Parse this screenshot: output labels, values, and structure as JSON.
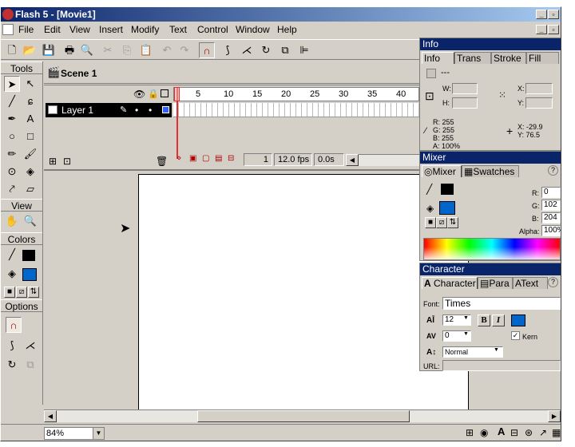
{
  "window": {
    "title": "Flash 5 - [Movie1]"
  },
  "menu": {
    "items": [
      "File",
      "Edit",
      "View",
      "Insert",
      "Modify",
      "Text",
      "Control",
      "Window",
      "Help"
    ]
  },
  "tools": {
    "tools_label": "Tools",
    "view_label": "View",
    "colors_label": "Colors",
    "options_label": "Options",
    "stroke_color": "#000000",
    "fill_color": "#0066cc"
  },
  "scene": {
    "label": "Scene 1"
  },
  "timeline": {
    "frame_numbers": [
      "5",
      "10",
      "15",
      "20",
      "25",
      "30",
      "35",
      "40"
    ],
    "layer_name": "Layer 1",
    "current_frame": "1",
    "fps": "12.0 fps",
    "elapsed": "0.0s"
  },
  "zoom": {
    "value": "84%"
  },
  "info_panel": {
    "title": "Info",
    "tabs": [
      "Info",
      "Trans",
      "Stroke",
      "Fill"
    ],
    "dashes": "---",
    "w_label": "W:",
    "h_label": "H:",
    "x_label": "X:",
    "y_label": "Y:",
    "r": "R: 255",
    "g": "G: 255",
    "b": "B: 255",
    "a": "A: 100%",
    "cursor_x": "X: -29.9",
    "cursor_y": "Y: 76.5"
  },
  "mixer_panel": {
    "title": "Mixer",
    "tabs": [
      "Mixer",
      "Swatches"
    ],
    "r_label": "R:",
    "r_value": "0",
    "g_label": "G:",
    "g_value": "102",
    "b_label": "B:",
    "b_value": "204",
    "alpha_label": "Alpha:",
    "alpha_value": "100%",
    "stroke_color": "#000000",
    "fill_color": "#0066cc"
  },
  "character_panel": {
    "title": "Character",
    "tabs": [
      "Character",
      "Para",
      "Text"
    ],
    "font_label": "Font:",
    "font_value": "Times",
    "size_value": "12",
    "kerning_value": "0",
    "kern_label": "Kern",
    "baseline_value": "Normal",
    "url_label": "URL:",
    "bold_label": "B",
    "italic_label": "I",
    "text_color": "#0066cc"
  }
}
